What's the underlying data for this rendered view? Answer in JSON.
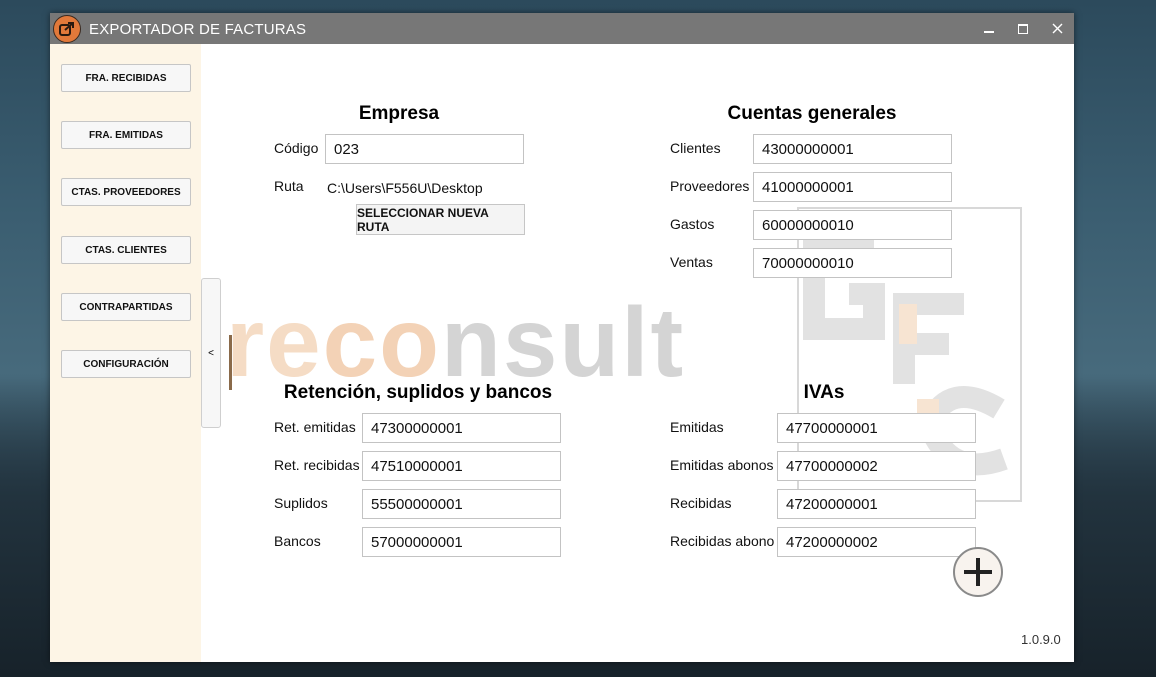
{
  "window": {
    "title": "EXPORTADOR DE FACTURAS",
    "controls": [
      "minimize",
      "maximize",
      "close"
    ]
  },
  "sidebar": {
    "items": [
      {
        "label": "FRA. RECIBIDAS"
      },
      {
        "label": "FRA. EMITIDAS"
      },
      {
        "label": "CTAS. PROVEEDORES"
      },
      {
        "label": "CTAS. CLIENTES"
      },
      {
        "label": "CONTRAPARTIDAS"
      },
      {
        "label": "CONFIGURACIÓN"
      }
    ],
    "collapse_label": "<"
  },
  "watermark": {
    "part1": "re",
    "part2": "co",
    "part3": "nsult"
  },
  "empresa": {
    "title": "Empresa",
    "codigo_label": "Código",
    "codigo_value": "023",
    "ruta_label": "Ruta",
    "ruta_value": "C:\\Users\\F556U\\Desktop",
    "select_button": "SELECCIONAR NUEVA RUTA"
  },
  "cuentas": {
    "title": "Cuentas generales",
    "clientes_label": "Clientes",
    "clientes_value": "43000000001",
    "proveedores_label": "Proveedores",
    "proveedores_value": "41000000001",
    "gastos_label": "Gastos",
    "gastos_value": "60000000010",
    "ventas_label": "Ventas",
    "ventas_value": "70000000010"
  },
  "retencion": {
    "title": "Retención, suplidos y bancos",
    "ret_emitidas_label": "Ret. emitidas",
    "ret_emitidas_value": "47300000001",
    "ret_recibidas_label": "Ret. recibidas",
    "ret_recibidas_value": "47510000001",
    "suplidos_label": "Suplidos",
    "suplidos_value": "55500000001",
    "bancos_label": "Bancos",
    "bancos_value": "57000000001"
  },
  "ivas": {
    "title": "IVAs",
    "emitidas_label": "Emitidas",
    "emitidas_value": "47700000001",
    "emitidas_abonos_label": "Emitidas abonos",
    "emitidas_abonos_value": "47700000002",
    "recibidas_label": "Recibidas",
    "recibidas_value": "47200000001",
    "recibidas_abono_label": "Recibidas abono",
    "recibidas_abono_value": "47200000002"
  },
  "version": "1.0.9.0",
  "colors": {
    "titlebar": "#777777",
    "sidebar": "#fdf5e6",
    "accent": "#e2793a"
  }
}
